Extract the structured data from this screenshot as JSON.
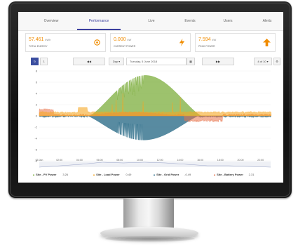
{
  "nav": {
    "tabs": [
      "Overview",
      "Performance",
      "Live",
      "Events",
      "Users",
      "Alerts"
    ],
    "active": "Performance"
  },
  "stats": [
    {
      "value": "57.461",
      "unit": "kWh",
      "label": "TOTAL ENERGY",
      "icon": "sun-icon"
    },
    {
      "value": "0.000",
      "unit": "kW",
      "label": "CURRENT POWER",
      "icon": "lightning-icon"
    },
    {
      "value": "7.594",
      "unit": "kW",
      "label": "PEAK POWER",
      "icon": "arrow-up-icon"
    }
  ],
  "toolbar": {
    "period": "Day ▾",
    "date": "Tuesday, 5 June 2018",
    "page": "4 of 10 ▾"
  },
  "chart_data": {
    "type": "area",
    "ylim": [
      -8,
      8
    ],
    "y_ticks": [
      "8",
      "6",
      "4",
      "2",
      "0",
      "-2",
      "-4",
      "-6",
      "-8"
    ],
    "x_ticks": [
      "05 Jun",
      "02:00",
      "04:00",
      "06:00",
      "08:00",
      "10:00",
      "12:00",
      "14:00",
      "16:00",
      "18:00",
      "20:00",
      "22:00"
    ],
    "series": [
      {
        "name": "Site - PV Power",
        "color": "#7cae3c",
        "current": "3.26"
      },
      {
        "name": "Site - Load Power",
        "color": "#f5a623",
        "current": "0.49"
      },
      {
        "name": "Site - Grid Power",
        "color": "#2e6e8a",
        "current": "-0.49"
      },
      {
        "name": "Site - Battery Power",
        "color": "#e8734a",
        "current": "2.31"
      }
    ]
  },
  "colors": {
    "accent": "#3b3f9e",
    "orange": "#f08c00"
  }
}
